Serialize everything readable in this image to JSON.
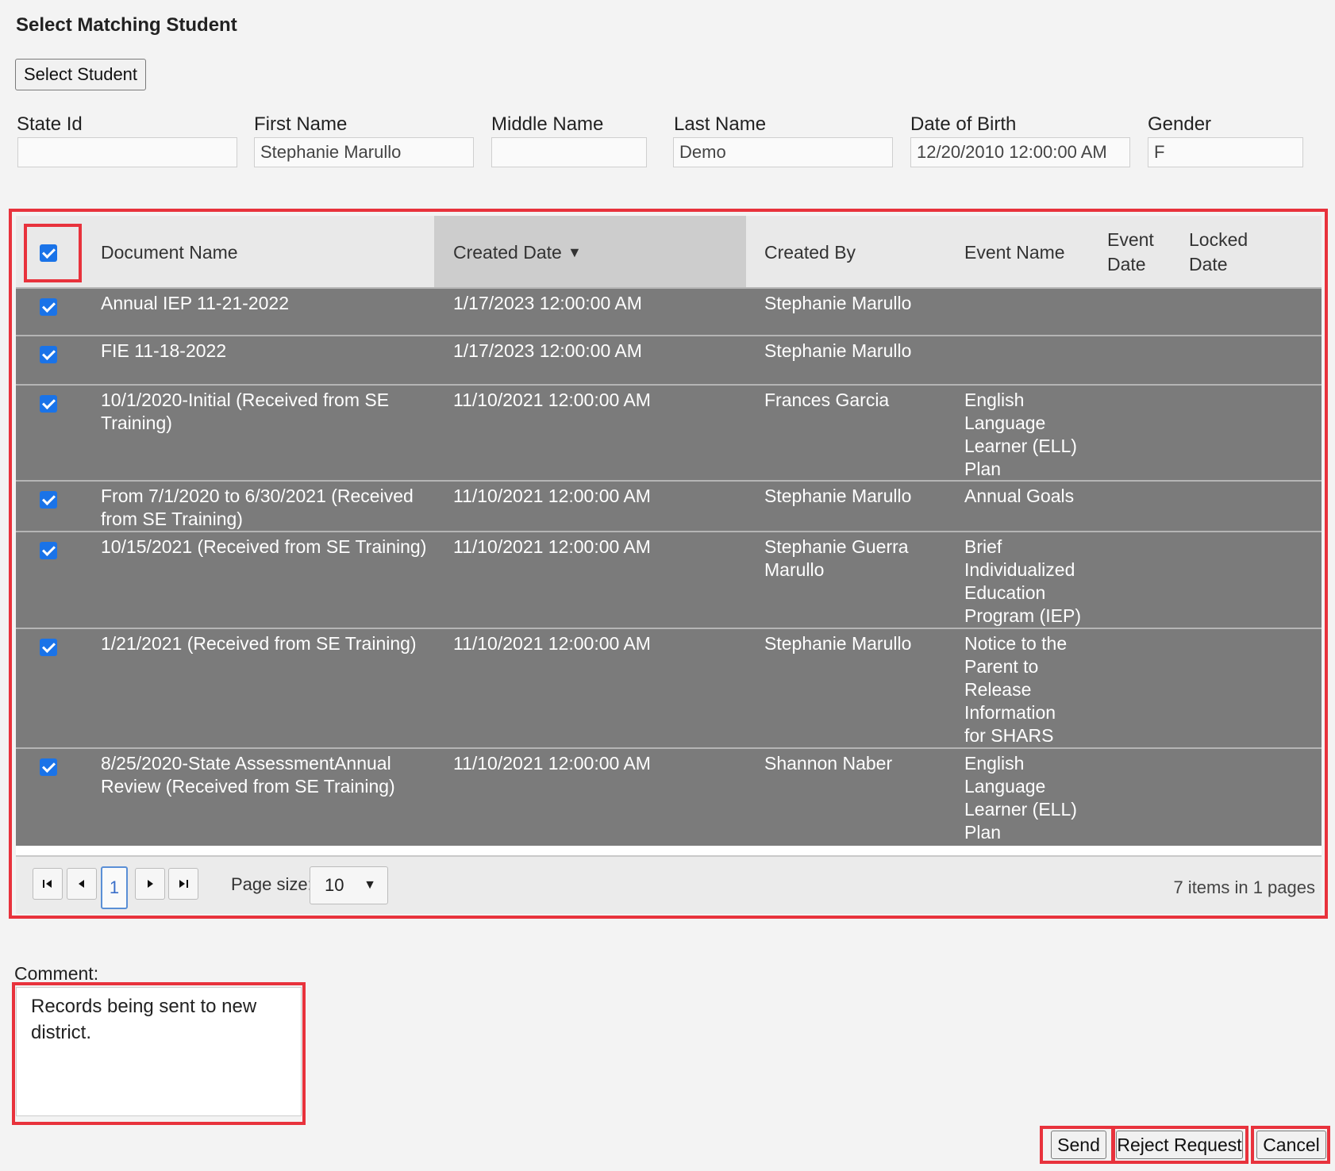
{
  "page": {
    "title": "Select Matching Student",
    "select_student_button": "Select Student"
  },
  "student": {
    "fields": [
      {
        "label": "State Id",
        "value": ""
      },
      {
        "label": "First Name",
        "value": "Stephanie Marullo"
      },
      {
        "label": "Middle Name",
        "value": ""
      },
      {
        "label": "Last Name",
        "value": "Demo"
      },
      {
        "label": "Date of Birth",
        "value": "12/20/2010 12:00:00 AM"
      },
      {
        "label": "Gender",
        "value": "F"
      }
    ]
  },
  "grid": {
    "select_all_checked": true,
    "columns": {
      "document_name": "Document Name",
      "created_date": "Created Date",
      "sort_indicator": "▼",
      "created_by": "Created By",
      "event_name": "Event Name",
      "event_date_1": "Event",
      "event_date_2": "Date",
      "locked_date_1": "Locked",
      "locked_date_2": "Date"
    },
    "rows": [
      {
        "checked": true,
        "document_name": "Annual IEP 11-21-2022",
        "created_date": "1/17/2023 12:00:00 AM",
        "created_by": "Stephanie Marullo",
        "event_name": "",
        "event_date": "",
        "locked_date": ""
      },
      {
        "checked": true,
        "document_name": "FIE 11-18-2022",
        "created_date": "1/17/2023 12:00:00 AM",
        "created_by": "Stephanie Marullo",
        "event_name": "",
        "event_date": "",
        "locked_date": ""
      },
      {
        "checked": true,
        "document_name": "10/1/2020-Initial (Received from SE Training)",
        "created_date": "11/10/2021 12:00:00 AM",
        "created_by": "Frances Garcia",
        "event_name": "English Language Learner (ELL) Plan",
        "event_date": "",
        "locked_date": ""
      },
      {
        "checked": true,
        "document_name": "From 7/1/2020 to 6/30/2021 (Received from SE Training)",
        "created_date": "11/10/2021 12:00:00 AM",
        "created_by": "Stephanie Marullo",
        "event_name": "Annual Goals",
        "event_date": "",
        "locked_date": ""
      },
      {
        "checked": true,
        "document_name": "10/15/2021 (Received from SE Training)",
        "created_date": "11/10/2021 12:00:00 AM",
        "created_by": "Stephanie Guerra Marullo",
        "event_name": "Brief Individualized Education Program (IEP)",
        "event_date": "",
        "locked_date": ""
      },
      {
        "checked": true,
        "document_name": "1/21/2021 (Received from SE Training)",
        "created_date": "11/10/2021 12:00:00 AM",
        "created_by": "Stephanie Marullo",
        "event_name": "Notice to the Parent to Release Information for SHARS",
        "event_date": "",
        "locked_date": ""
      },
      {
        "checked": true,
        "document_name": "8/25/2020-State AssessmentAnnual Review (Received from SE Training)",
        "created_date": "11/10/2021 12:00:00 AM",
        "created_by": "Shannon Naber",
        "event_name": "English Language Learner (ELL) Plan",
        "event_date": "",
        "locked_date": ""
      }
    ],
    "pager": {
      "current_page": "1",
      "page_size_label": "Page size:",
      "page_size": "10",
      "info": "7 items in 1 pages"
    }
  },
  "comment": {
    "label": "Comment:",
    "value": "Records being sent to new district."
  },
  "actions": {
    "send": "Send",
    "reject": "Reject Request",
    "cancel": "Cancel"
  },
  "colors": {
    "highlight": "#e8323c",
    "row_bg": "#7b7b7b",
    "checkbox": "#1a73e8"
  }
}
